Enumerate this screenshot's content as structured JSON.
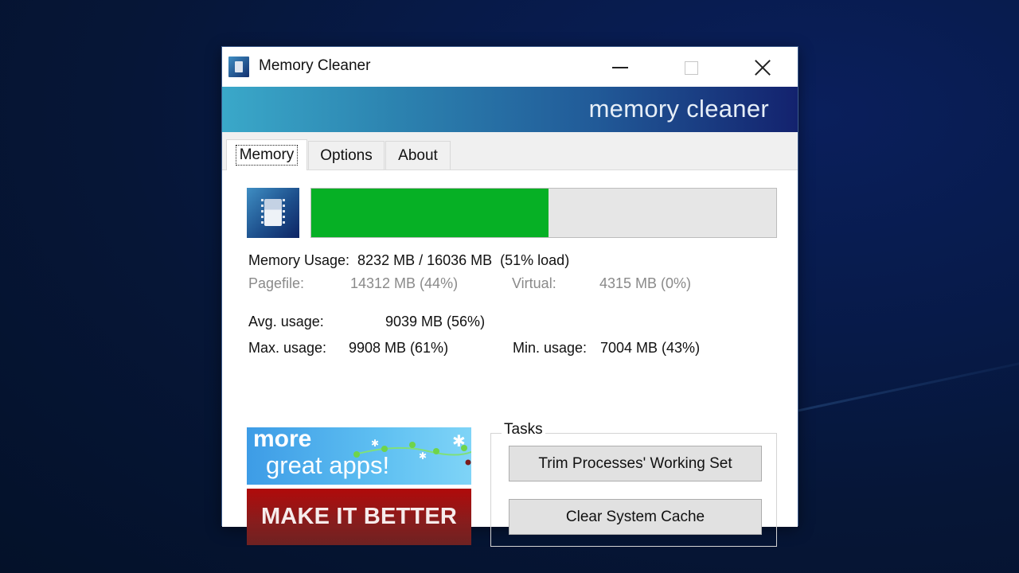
{
  "window": {
    "title": "Memory Cleaner",
    "banner_text": "memory cleaner",
    "controls": {
      "minimize": "minimize",
      "maximize": "maximize",
      "close": "close"
    }
  },
  "tabs": [
    {
      "label": "Memory",
      "active": true
    },
    {
      "label": "Options",
      "active": false
    },
    {
      "label": "About",
      "active": false
    }
  ],
  "memory": {
    "load_percent": 51,
    "bar_color": "#06b025",
    "usage_line": "Memory Usage:  8232 MB / 16036 MB  (51% load)",
    "pagefile_label": "Pagefile:",
    "pagefile_value": "14312 MB (44%)",
    "virtual_label": "Virtual:",
    "virtual_value": "4315 MB (0%)",
    "avg_label": "Avg. usage:",
    "avg_value": "9039 MB (56%)",
    "max_label": "Max. usage:",
    "max_value": "9908 MB (61%)",
    "min_label": "Min. usage:",
    "min_value": "7004 MB (43%)"
  },
  "ads": {
    "more_line1": "more",
    "more_line2": "great apps!",
    "better": "MAKE IT BETTER"
  },
  "tasks": {
    "label": "Tasks",
    "trim_button": "Trim Processes' Working Set",
    "clear_button": "Clear System Cache"
  }
}
